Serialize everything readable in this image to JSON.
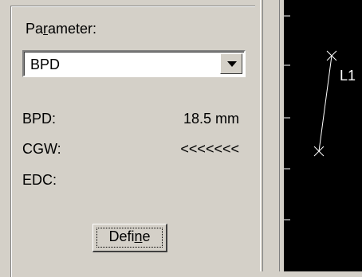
{
  "parameter": {
    "label_pre": "Pa",
    "label_accel": "r",
    "label_post": "ameter:",
    "selected": "BPD"
  },
  "measurements": [
    {
      "label": "BPD:",
      "value": "18.5 mm"
    },
    {
      "label": "CGW:",
      "value": "<<<<<<<"
    },
    {
      "label": "EDC:",
      "value": ""
    }
  ],
  "define_button": {
    "label_pre": "Defi",
    "label_accel": "n",
    "label_post": "e"
  },
  "image_view": {
    "line_label": "L1"
  }
}
